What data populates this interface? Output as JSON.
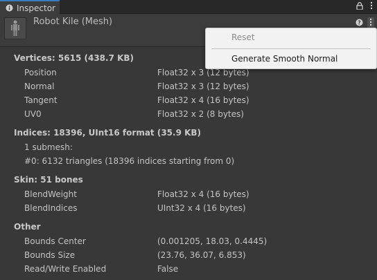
{
  "tab": {
    "title": "Inspector",
    "icons": [
      "info-icon",
      "lock-icon",
      "kebab-menu-icon"
    ]
  },
  "header": {
    "title": "Robot Kile (Mesh)",
    "icons": [
      "help-icon",
      "overflow-menu-icon"
    ]
  },
  "vertices": {
    "title": "Vertices: 5615 (438.7 KB)",
    "rows": [
      {
        "k": "Position",
        "v": "Float32 x 3 (12 bytes)"
      },
      {
        "k": "Normal",
        "v": "Float32 x 3 (12 bytes)"
      },
      {
        "k": "Tangent",
        "v": "Float32 x 4 (16 bytes)"
      },
      {
        "k": "UV0",
        "v": "Float32 x 2 (8 bytes)"
      }
    ]
  },
  "indices": {
    "title": "Indices: 18396, UInt16 format (35.9 KB)",
    "line1": "1 submesh:",
    "line2": "#0: 6132 triangles (18396 indices starting from 0)"
  },
  "skin": {
    "title": "Skin: 51 bones",
    "rows": [
      {
        "k": "BlendWeight",
        "v": "Float32 x 4 (16 bytes)"
      },
      {
        "k": "BlendIndices",
        "v": "UInt32 x 4 (16 bytes)"
      }
    ]
  },
  "other": {
    "title": "Other",
    "rows": [
      {
        "k": "Bounds Center",
        "v": "(0.001205, 18.03, 0.4445)"
      },
      {
        "k": "Bounds Size",
        "v": "(23.76, 36.07, 6.853)"
      },
      {
        "k": "Read/Write Enabled",
        "v": "False"
      }
    ]
  },
  "menu": {
    "reset": "Reset",
    "generate": "Generate Smooth Normal"
  }
}
